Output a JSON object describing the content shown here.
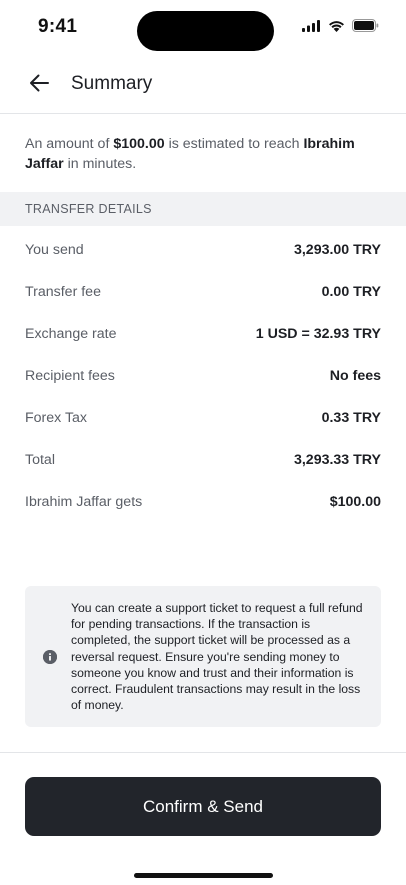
{
  "status_bar": {
    "time": "9:41"
  },
  "header": {
    "title": "Summary"
  },
  "intro": {
    "prefix": "An amount of ",
    "amount": "$100.00",
    "middle": " is estimated to reach ",
    "recipient": "Ibrahim Jaffar",
    "suffix": " in minutes."
  },
  "section": {
    "title": "TRANSFER DETAILS"
  },
  "details": [
    {
      "label": "You send",
      "value": "3,293.00 TRY"
    },
    {
      "label": "Transfer fee",
      "value": "0.00 TRY"
    },
    {
      "label": "Exchange rate",
      "value": "1 USD = 32.93 TRY"
    },
    {
      "label": "Recipient fees",
      "value": "No fees"
    },
    {
      "label": "Forex Tax",
      "value": "0.33 TRY"
    },
    {
      "label": "Total",
      "value": "3,293.33 TRY"
    },
    {
      "label": "Ibrahim Jaffar gets",
      "value": "$100.00"
    }
  ],
  "info": {
    "icon": "info-icon",
    "text": "You can create a support ticket to request a full refund for pending transactions. If the transaction is completed, the support ticket will be processed as a reversal request. Ensure you're sending money to someone you know and trust and their information is correct. Fraudulent transactions may result in the loss of money."
  },
  "actions": {
    "confirm_label": "Confirm & Send"
  },
  "colors": {
    "button_bg": "#22252b",
    "section_bg": "#f1f2f4",
    "muted_text": "#5a5e66"
  }
}
